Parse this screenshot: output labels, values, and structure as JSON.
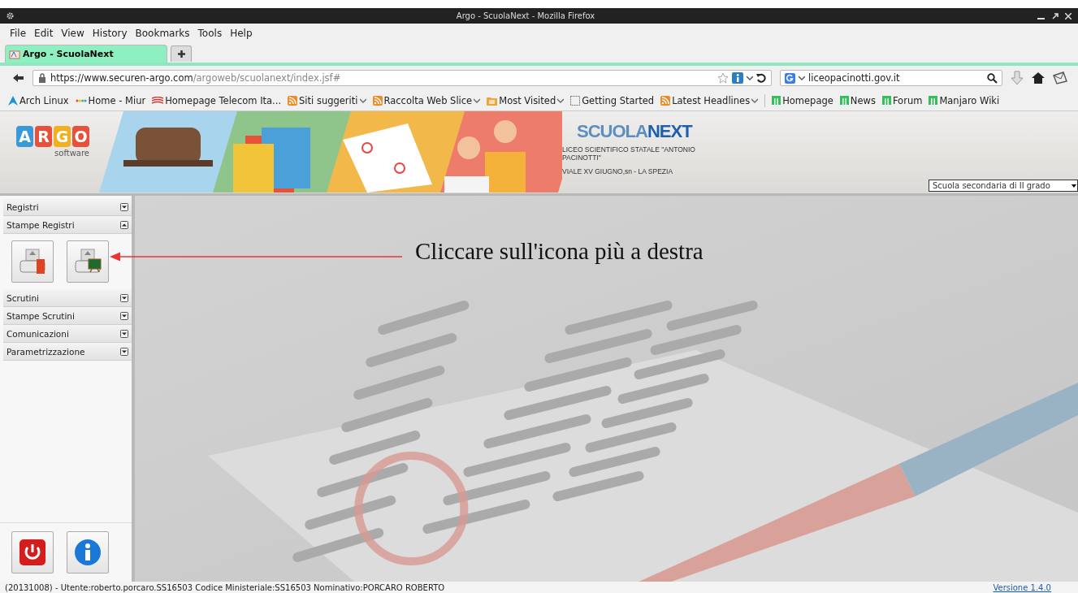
{
  "window": {
    "title": "Argo - ScuolaNext - Mozilla Firefox"
  },
  "menu": [
    "File",
    "Edit",
    "View",
    "History",
    "Bookmarks",
    "Tools",
    "Help"
  ],
  "tabs": [
    {
      "label": "Argo - ScuolaNext",
      "selected": true
    }
  ],
  "navigation": {
    "url_host": "https://www.securen-argo.com",
    "url_path": "/argoweb/scuolanext/index.jsf#",
    "search_value": "liceopacinotti.gov.it"
  },
  "bookmarks": [
    {
      "label": "Arch Linux",
      "kind": "arch",
      "dropdown": false
    },
    {
      "label": "Home - Miur",
      "kind": "miur",
      "dropdown": false
    },
    {
      "label": "Homepage Telecom Ita...",
      "kind": "telecom",
      "dropdown": false
    },
    {
      "label": "Siti suggeriti",
      "kind": "rss",
      "dropdown": true
    },
    {
      "label": "Raccolta Web Slice",
      "kind": "rss",
      "dropdown": true
    },
    {
      "label": "Most Visited",
      "kind": "folder",
      "dropdown": true
    },
    {
      "label": "Getting Started",
      "kind": "blank",
      "dropdown": false
    },
    {
      "label": "Latest Headlines",
      "kind": "rss",
      "dropdown": true
    },
    {
      "label": "Homepage",
      "kind": "manjaro",
      "dropdown": false
    },
    {
      "label": "News",
      "kind": "manjaro",
      "dropdown": false
    },
    {
      "label": "Forum",
      "kind": "manjaro",
      "dropdown": false
    },
    {
      "label": "Manjaro Wiki",
      "kind": "manjaro",
      "dropdown": false
    }
  ],
  "banner": {
    "logo_letters": [
      "A",
      "R",
      "G",
      "O"
    ],
    "logo_subtitle": "software",
    "product_parts": [
      "SCUOLA",
      "NEXT"
    ],
    "school_name": "LICEO SCIENTIFICO STATALE \"ANTONIO PACINOTTI\"",
    "school_address": "VIALE XV GIUGNO,sn - LA SPEZIA",
    "school_type": "Scuola secondaria di II grado"
  },
  "sidebar": {
    "sections": [
      {
        "label": "Registri",
        "expanded": false
      },
      {
        "label": "Stampe Registri",
        "expanded": true
      },
      {
        "label": "Scrutini",
        "expanded": false
      },
      {
        "label": "Stampe Scrutini",
        "expanded": false
      },
      {
        "label": "Comunicazioni",
        "expanded": false
      },
      {
        "label": "Parametrizzazione",
        "expanded": false
      }
    ]
  },
  "annotation": {
    "text": "Cliccare sull'icona più a destra"
  },
  "status_bar": {
    "text": "(20131008) - Utente:roberto.porcaro.SS16503 Codice Ministeriale:SS16503 Nominativo:PORCARO ROBERTO",
    "version_link": "Versione 1.4.0"
  }
}
